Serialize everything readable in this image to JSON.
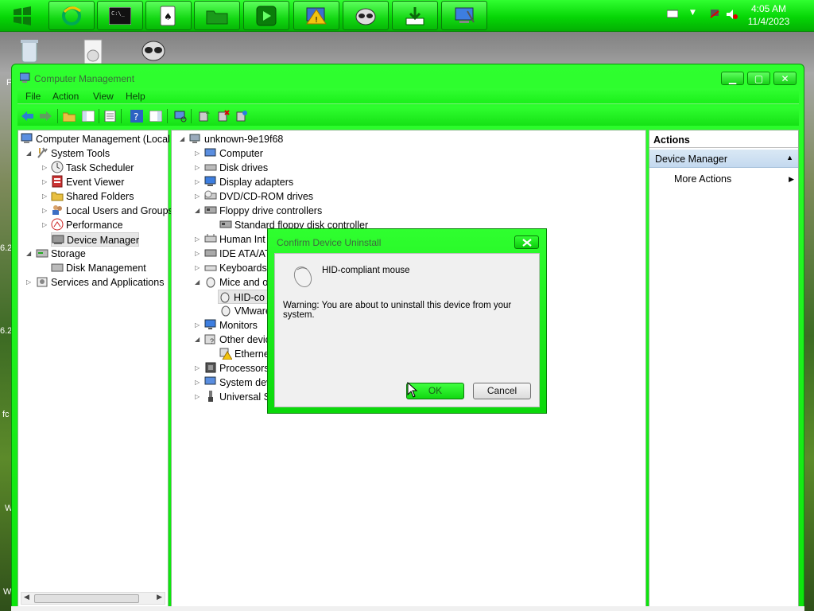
{
  "taskbar": {
    "apps": [
      {
        "name": "Internet Explorer",
        "icon": "ie-icon"
      },
      {
        "name": "Command Prompt",
        "icon": "terminal-icon"
      },
      {
        "name": "Solitaire",
        "icon": "cards-icon"
      },
      {
        "name": "File Explorer",
        "icon": "folder-icon"
      },
      {
        "name": "Media Player",
        "icon": "play-icon"
      },
      {
        "name": "Windows Update",
        "icon": "update-icon"
      },
      {
        "name": "Raccoon App",
        "icon": "raccoon-icon"
      },
      {
        "name": "Download",
        "icon": "download-icon"
      },
      {
        "name": "Computer Management",
        "icon": "computer-mgmt-icon"
      }
    ],
    "clock": {
      "time": "4:05 AM",
      "date": "11/4/2023"
    }
  },
  "desktop": {
    "fragments": [
      "F",
      "6.2",
      "6.2",
      "fc",
      "W",
      "W"
    ]
  },
  "window": {
    "title": "Computer Management",
    "menu": [
      "File",
      "Action",
      "View",
      "Help"
    ]
  },
  "tree": {
    "root": "Computer Management (Local",
    "system_tools": "System Tools",
    "task_scheduler": "Task Scheduler",
    "event_viewer": "Event Viewer",
    "shared_folders": "Shared Folders",
    "local_users": "Local Users and Groups",
    "performance": "Performance",
    "device_manager": "Device Manager",
    "storage": "Storage",
    "disk_management": "Disk Management",
    "services_apps": "Services and Applications"
  },
  "devices": {
    "host": "unknown-9e19f68",
    "computer": "Computer",
    "disk_drives": "Disk drives",
    "display_adapters": "Display adapters",
    "dvd": "DVD/CD-ROM drives",
    "floppy_controllers": "Floppy drive controllers",
    "floppy_child": "Standard floppy disk controller",
    "human_interface": "Human Int",
    "ide": "IDE ATA/AT",
    "keyboards": "Keyboards",
    "mice": "Mice and o",
    "hid_mouse": "HID-co",
    "vmware_mouse": "VMware",
    "monitors": "Monitors",
    "other_devices": "Other devic",
    "ethernet": "Etherne",
    "processors": "Processors",
    "system_devices": "System dev",
    "usb": "Universal S"
  },
  "actions": {
    "header": "Actions",
    "section": "Device Manager",
    "more": "More Actions"
  },
  "dialog": {
    "title": "Confirm Device Uninstall",
    "device": "HID-compliant mouse",
    "warning": "Warning: You are about to uninstall this device from your system.",
    "ok": "OK",
    "cancel": "Cancel"
  }
}
